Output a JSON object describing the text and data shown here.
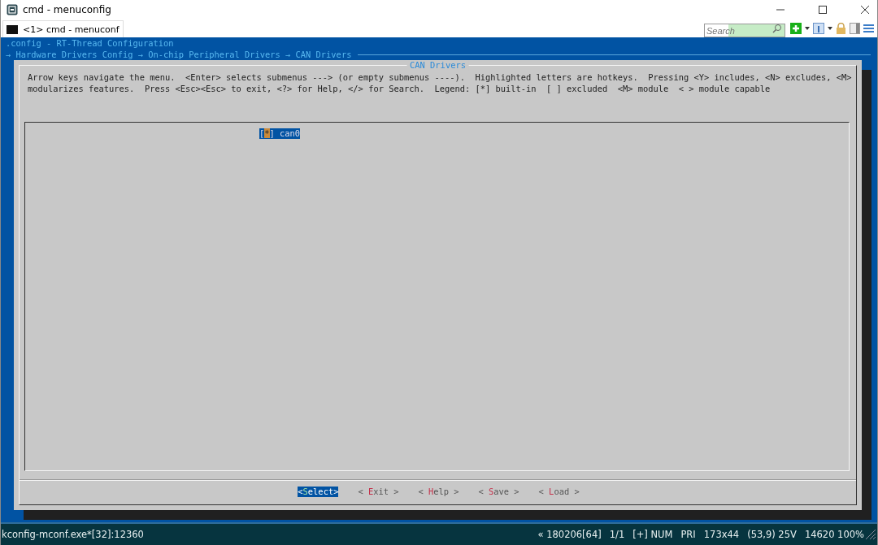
{
  "window": {
    "title": "cmd - menuconfig"
  },
  "tabs": [
    {
      "label": "<1> cmd - menuconf",
      "selected": true
    }
  ],
  "search": {
    "placeholder": "Search"
  },
  "terminal": {
    "title": ".config - RT-Thread Configuration",
    "breadcrumb": "→ Hardware Drivers Config → On-chip Peripheral Drivers → CAN Drivers",
    "dialog": {
      "title": "CAN Drivers",
      "help": [
        "Arrow keys navigate the menu.  <Enter> selects submenus ---> (or empty submenus ----).  Highlighted letters are hotkeys.  Pressing <Y> includes, <N> excludes, <M>",
        "modularizes features.  Press <Esc><Esc> to exit, <?> for Help, </> for Search.  Legend: [*] built-in  [ ] excluded  <M> module  < > module capable"
      ],
      "items": [
        {
          "before": "[",
          "key": "*",
          "after": "] can0",
          "selected": true
        }
      ],
      "buttons": [
        {
          "before": "<",
          "key": "S",
          "after": "elect>",
          "selected": true
        },
        {
          "before": "< ",
          "key": "E",
          "after": "xit >",
          "selected": false
        },
        {
          "before": "< ",
          "key": "H",
          "after": "elp >",
          "selected": false
        },
        {
          "before": "< ",
          "key": "S",
          "after": "ave >",
          "selected": false
        },
        {
          "before": "< ",
          "key": "L",
          "after": "oad >",
          "selected": false
        }
      ]
    }
  },
  "status_bar": {
    "left": "kconfig-mconf.exe*[32]:12360",
    "right": [
      "« 180206[64]",
      "1/1",
      "[+] NUM",
      "PRI",
      "173x44",
      "(53,9) 25V",
      "14620 100%"
    ]
  }
}
